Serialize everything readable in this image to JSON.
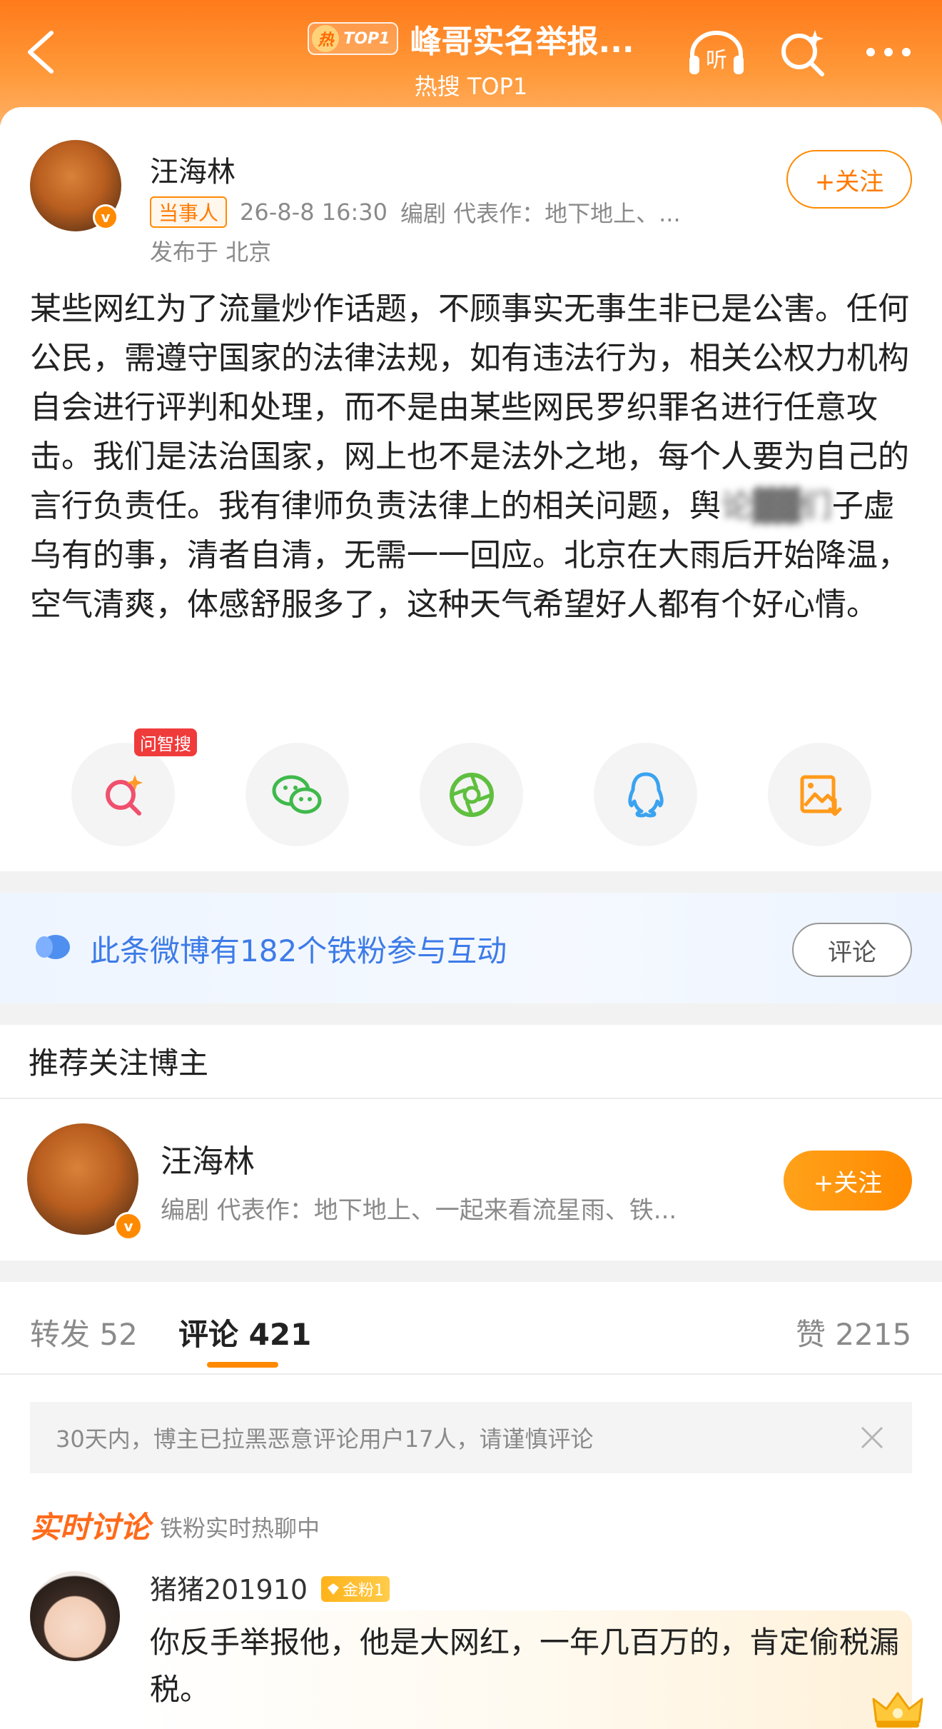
{
  "header": {
    "hot_badge_char": "热",
    "hot_badge_rank": "TOP1",
    "title": "峰哥实名举报...",
    "subtitle": "热搜 TOP1",
    "listen_label": "听"
  },
  "post": {
    "author": "汪海林",
    "verified_mark": "v",
    "role_tag": "当事人",
    "time": "26-8-8 16:30",
    "bio": "编剧  代表作：地下地上、...",
    "location": "发布于 北京",
    "follow_label": "+关注",
    "body_before": "某些网红为了流量炒作话题，不顾事实无事生非已是公害。任何公民，需遵守国家的法律法规，如有违法行为，相关公权力机构自会进行评判和处理，而不是由某些网民罗织罪名进行任意攻击。我们是法治国家，网上也不是法外之地，每个人要为自己的言行负责任。我有律师负责法律上的相关问题，舆",
    "body_blurred": "论▓▓们",
    "body_after": "子虚乌有的事，清者自清，无需一一回应。北京在大雨后开始降温，空气清爽，体感舒服多了，这种天气希望好人都有个好心情。"
  },
  "share": {
    "ask_badge": "问智搜",
    "items": [
      "ask-zhisou",
      "wechat",
      "moments",
      "qq",
      "save-image"
    ]
  },
  "fan_banner": {
    "text": "此条微博有182个铁粉参与互动",
    "comment_button": "评论"
  },
  "recommend": {
    "section_title": "推荐关注博主",
    "name": "汪海林",
    "desc": "编剧  代表作：地下地上、一起来看流星雨、铁...",
    "follow_label": "+关注"
  },
  "tabs": {
    "repost": "转发 52",
    "comment": "评论 421",
    "like": "赞 2215"
  },
  "notice": "30天内，博主已拉黑恶意评论用户17人，请谨慎评论",
  "realtime": {
    "title": "实时讨论",
    "subtitle": "铁粉实时热聊中"
  },
  "comment": {
    "user": "猪猪201910",
    "fan_level": "金粉1",
    "text": "你反手举报他，他是大网红，一年几百万的，肯定偷税漏税。"
  },
  "colors": {
    "accent_orange": "#ff8a00",
    "header_gradient_top": "#ff7a1a",
    "link_blue": "#3d7be8",
    "realtime_red_orange": "#ff6a1a"
  }
}
